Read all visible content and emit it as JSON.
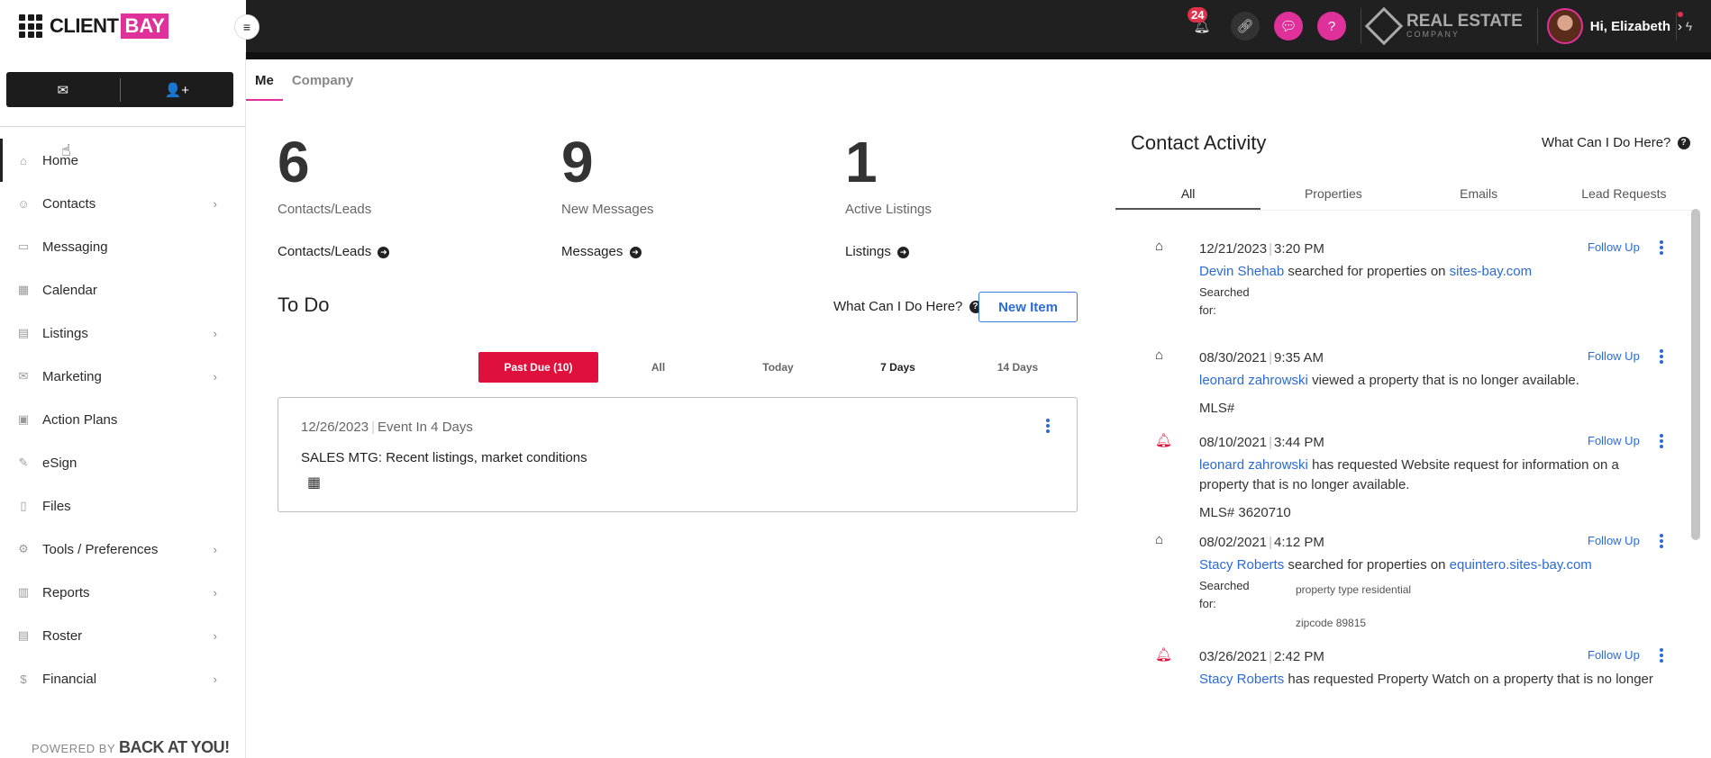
{
  "app": {
    "brand_a": "CLIENT",
    "brand_b": "BAY",
    "powered_pre": "POWERED BY",
    "powered_brand": "BACK AT YOU!"
  },
  "topbar": {
    "notifications_count": "24",
    "company_name": "REAL ESTATE",
    "company_sub": "COMPANY",
    "greeting": "Hi, Elizabeth",
    "accent": "#e0319a"
  },
  "sidebar": {
    "items": [
      {
        "label": "Home",
        "icon": "home-icon",
        "glyph": "⌂",
        "chevron": false,
        "active": true
      },
      {
        "label": "Contacts",
        "icon": "contacts-icon",
        "glyph": "☺",
        "chevron": true
      },
      {
        "label": "Messaging",
        "icon": "message-icon",
        "glyph": "▭",
        "chevron": false
      },
      {
        "label": "Calendar",
        "icon": "calendar-icon",
        "glyph": "▦",
        "chevron": false
      },
      {
        "label": "Listings",
        "icon": "listings-icon",
        "glyph": "▤",
        "chevron": true
      },
      {
        "label": "Marketing",
        "icon": "marketing-icon",
        "glyph": "✉",
        "chevron": true
      },
      {
        "label": "Action Plans",
        "icon": "action-plans-icon",
        "glyph": "▣",
        "chevron": false
      },
      {
        "label": "eSign",
        "icon": "esign-icon",
        "glyph": "✎",
        "chevron": false
      },
      {
        "label": "Files",
        "icon": "files-icon",
        "glyph": "▯",
        "chevron": false
      },
      {
        "label": "Tools / Preferences",
        "icon": "tools-icon",
        "glyph": "⚙",
        "chevron": true
      },
      {
        "label": "Reports",
        "icon": "reports-icon",
        "glyph": "▥",
        "chevron": true
      },
      {
        "label": "Roster",
        "icon": "roster-icon",
        "glyph": "▤",
        "chevron": true
      },
      {
        "label": "Financial",
        "icon": "financial-icon",
        "glyph": "$",
        "chevron": true
      }
    ]
  },
  "subtabs": {
    "me": "Me",
    "company": "Company"
  },
  "stats": [
    {
      "value": "6",
      "label": "Contacts/Leads",
      "link": "Contacts/Leads"
    },
    {
      "value": "9",
      "label": "New Messages",
      "link": "Messages"
    },
    {
      "value": "1",
      "label": "Active Listings",
      "link": "Listings"
    }
  ],
  "todo": {
    "title": "To Do",
    "help": "What Can I Do Here?",
    "new_item": "New Item",
    "filters": [
      "Past Due (10)",
      "All",
      "Today",
      "7 Days",
      "14 Days"
    ],
    "card": {
      "date": "12/26/2023",
      "event": "Event In 4 Days",
      "title": "SALES MTG: Recent listings, market conditions"
    }
  },
  "contact_activity": {
    "title": "Contact Activity",
    "help": "What Can I Do Here?",
    "tabs": [
      "All",
      "Properties",
      "Emails",
      "Lead Requests"
    ],
    "follow_up": "Follow Up",
    "items": [
      {
        "date": "12/21/2023",
        "time": "3:20 PM",
        "name": "Devin Shehab",
        "text": " searched for properties on ",
        "link": "sites-bay.com",
        "searched": "Searched for:"
      },
      {
        "date": "08/30/2021",
        "time": "9:35 AM",
        "name": "leonard zahrowski",
        "text": " viewed a property that is no longer available.",
        "extra": "MLS#"
      },
      {
        "date": "08/10/2021",
        "time": "3:44 PM",
        "name": "leonard zahrowski",
        "text": " has requested Website request for information on a property that is no longer available.",
        "extra": "MLS# 3620710"
      },
      {
        "date": "08/02/2021",
        "time": "4:12 PM",
        "name": "Stacy Roberts",
        "text": " searched for properties on ",
        "link": "equintero.sites-bay.com",
        "searched": "Searched for:",
        "criteria": [
          "property type residential",
          "zipcode 89815"
        ]
      },
      {
        "date": "03/26/2021",
        "time": "2:42 PM",
        "name": "Stacy Roberts",
        "text": " has requested Property Watch on a property that is no longer"
      }
    ]
  }
}
